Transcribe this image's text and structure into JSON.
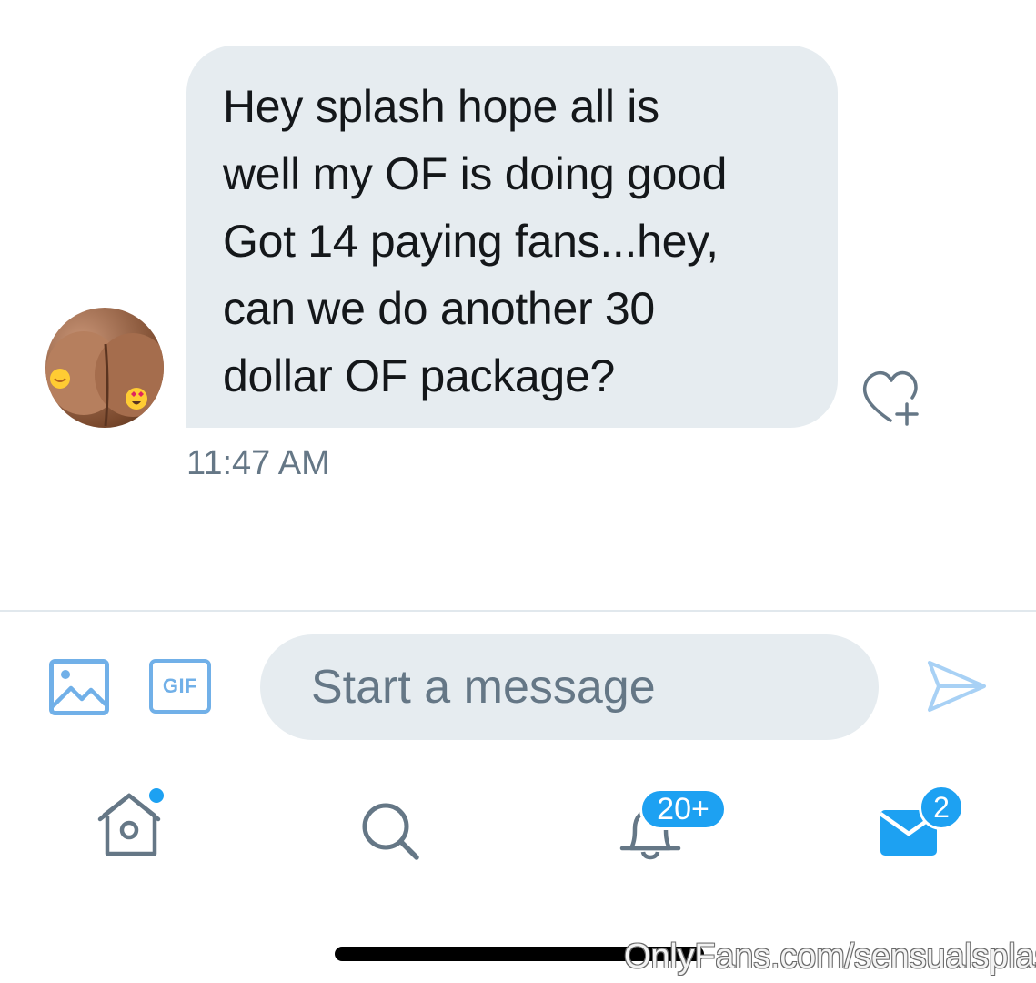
{
  "conversation": {
    "message": {
      "text": "Hey splash hope all is\nwell my OF is doing good\nGot 14 paying fans...hey,\ncan we do another 30\ndollar OF package?",
      "timestamp": "11:47 AM",
      "avatar_icon": "user-avatar"
    },
    "react_icon": "heart-plus-icon"
  },
  "composer": {
    "media_icon": "image-icon",
    "gif_label": "GIF",
    "placeholder": "Start a message",
    "value": "",
    "send_icon": "send-icon"
  },
  "bottom_nav": {
    "home_icon": "home-icon",
    "search_icon": "search-icon",
    "notifications_icon": "bell-icon",
    "notifications_badge": "20+",
    "messages_icon": "mail-icon",
    "messages_badge": "2"
  },
  "watermark": "OnlyFans.com/sensualsplash",
  "colors": {
    "accent": "#1da1f2",
    "accent_light": "#71b0e8",
    "bubble": "#e6ecf0",
    "text": "#14171a",
    "muted": "#657786"
  }
}
